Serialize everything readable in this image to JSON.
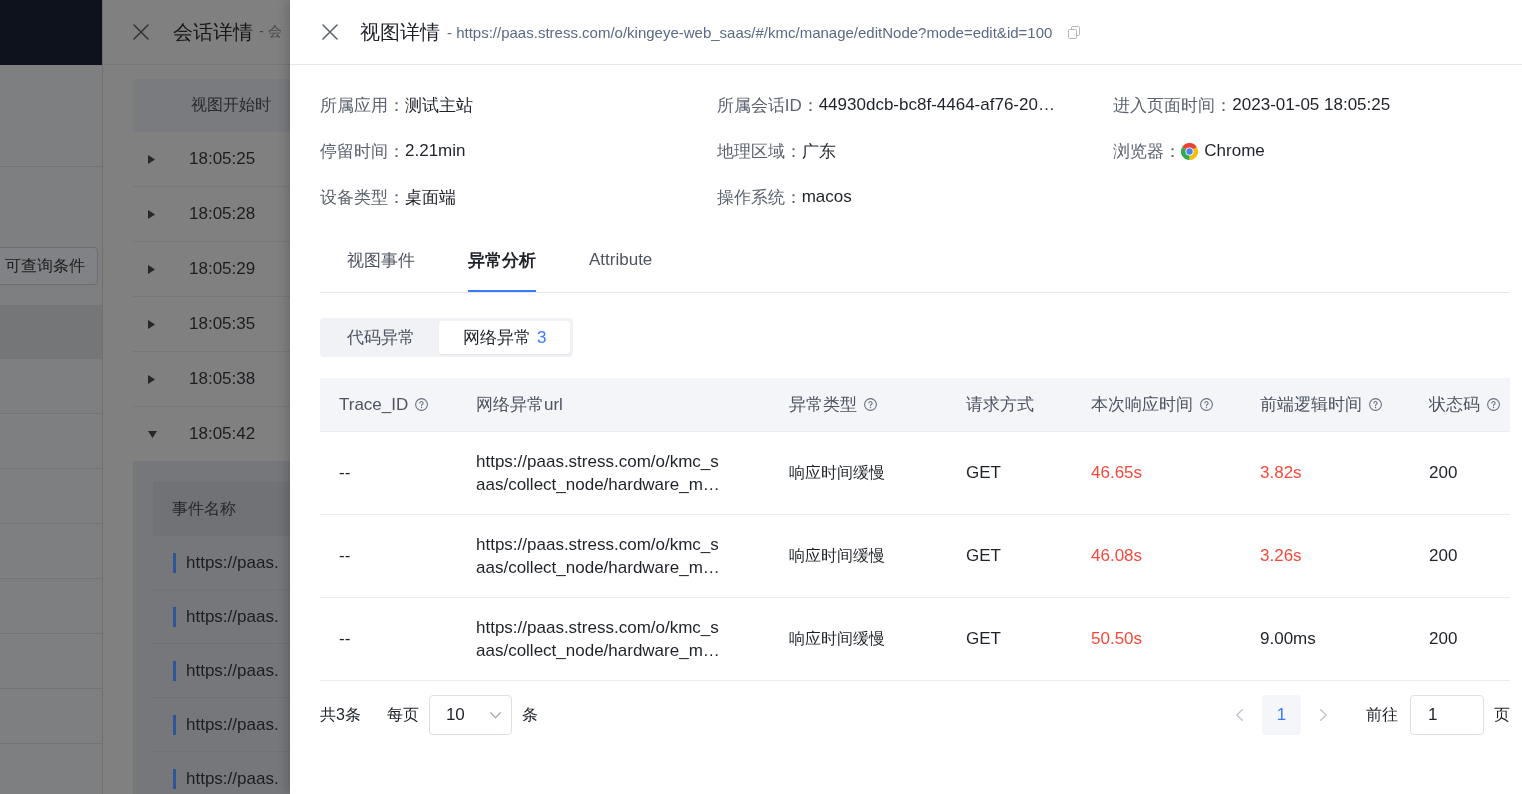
{
  "background_page": {
    "filter_button": "可查询条件"
  },
  "session_drawer": {
    "title": "会话详情",
    "subtitle": "- 会",
    "table": {
      "column": "视图开始时",
      "rows": [
        {
          "time": "18:05:25",
          "expanded": false
        },
        {
          "time": "18:05:28",
          "expanded": false
        },
        {
          "time": "18:05:29",
          "expanded": false
        },
        {
          "time": "18:05:35",
          "expanded": false
        },
        {
          "time": "18:05:38",
          "expanded": false
        },
        {
          "time": "18:05:42",
          "expanded": true,
          "events": {
            "column": "事件名称",
            "rows": [
              "https://paas.",
              "https://paas.",
              "https://paas.",
              "https://paas.",
              "https://paas."
            ]
          }
        }
      ]
    }
  },
  "drawer": {
    "title": "视图详情",
    "subtitle": "- https://paas.stress.com/o/kingeye-web_saas/#/kmc/manage/editNode?mode=edit&id=100",
    "info": [
      {
        "kind": "text",
        "label": "所属应用：",
        "value": "测试主站"
      },
      {
        "kind": "text",
        "label": "所属会话ID：",
        "value": "44930dcb-bc8f-4464-af76-20…"
      },
      {
        "kind": "text",
        "label": "进入页面时间：",
        "value": "2023-01-05 18:05:25"
      },
      {
        "kind": "text",
        "label": "停留时间：",
        "value": "2.21min"
      },
      {
        "kind": "text",
        "label": "地理区域：",
        "value": "广东"
      },
      {
        "kind": "browser",
        "label": "浏览器：",
        "value": "Chrome"
      },
      {
        "kind": "text",
        "label": "设备类型：",
        "value": "桌面端"
      },
      {
        "kind": "text",
        "label": "操作系统：",
        "value": "macos"
      }
    ],
    "tabs": [
      {
        "label": "视图事件",
        "selected": false
      },
      {
        "label": "异常分析",
        "selected": true
      },
      {
        "label": "Attribute",
        "selected": false
      }
    ],
    "segments": [
      {
        "label": "代码异常",
        "selected": false
      },
      {
        "label": "网络异常",
        "count": "3",
        "selected": true
      }
    ],
    "table": {
      "columns": [
        {
          "label": "Trace_ID",
          "help": true
        },
        {
          "label": "网络异常url",
          "help": false
        },
        {
          "label": "异常类型",
          "help": true
        },
        {
          "label": "请求方式",
          "help": false
        },
        {
          "label": "本次响应时间",
          "help": true
        },
        {
          "label": "前端逻辑时间",
          "help": true
        },
        {
          "label": "状态码",
          "help": true
        }
      ],
      "rows": [
        {
          "trace_id": "--",
          "url": "https://paas.stress.com/o/kmc_saas/collect_node/hardware_m…",
          "type": "响应时间缓慢",
          "method": "GET",
          "response_time": {
            "text": "46.65s",
            "alert": true
          },
          "logic_time": {
            "text": "3.82s",
            "alert": true
          },
          "status": "200"
        },
        {
          "trace_id": "--",
          "url": "https://paas.stress.com/o/kmc_saas/collect_node/hardware_m…",
          "type": "响应时间缓慢",
          "method": "GET",
          "response_time": {
            "text": "46.08s",
            "alert": true
          },
          "logic_time": {
            "text": "3.26s",
            "alert": true
          },
          "status": "200"
        },
        {
          "trace_id": "--",
          "url": "https://paas.stress.com/o/kmc_saas/collect_node/hardware_m…",
          "type": "响应时间缓慢",
          "method": "GET",
          "response_time": {
            "text": "50.50s",
            "alert": true
          },
          "logic_time": {
            "text": "9.00ms",
            "alert": false
          },
          "status": "200"
        }
      ]
    },
    "pagination": {
      "total": "共3条",
      "page_size_label": "每页",
      "page_size": "10",
      "page_size_unit": "条",
      "prev_disabled": true,
      "pages": [
        {
          "label": "1",
          "selected": true
        }
      ],
      "next_disabled": true,
      "jump_label": "前往",
      "jump_value": "1",
      "jump_unit": "页"
    }
  }
}
